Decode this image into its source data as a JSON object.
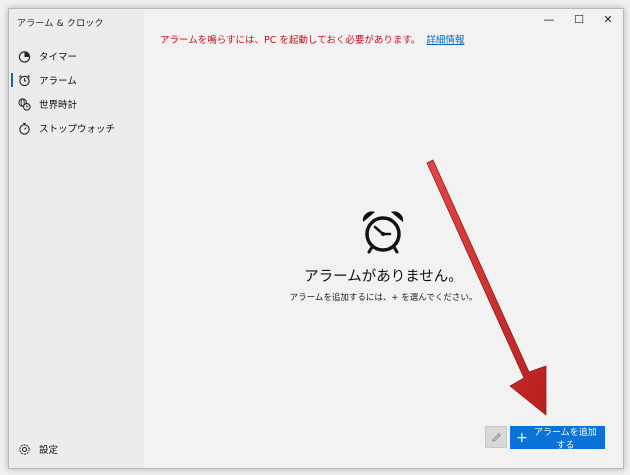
{
  "app": {
    "title": "アラーム & クロック"
  },
  "sidebar": {
    "items": [
      {
        "label": "タイマー",
        "icon": "timer-icon",
        "active": false
      },
      {
        "label": "アラーム",
        "icon": "alarm-icon",
        "active": true
      },
      {
        "label": "世界時計",
        "icon": "world-clock-icon",
        "active": false
      },
      {
        "label": "ストップウォッチ",
        "icon": "stopwatch-icon",
        "active": false
      }
    ],
    "settings_label": "設定"
  },
  "window_controls": {
    "minimize": "—",
    "maximize": "☐",
    "close": "✕"
  },
  "notice": {
    "text": "アラームを鳴らすには、PC を起動しておく必要があります。",
    "link": "詳細情報"
  },
  "empty_state": {
    "title": "アラームがありません。",
    "subtitle": "アラームを追加するには、+ を選んでください。"
  },
  "actions": {
    "add_label": "アラームを追加する"
  },
  "colors": {
    "accent": "#0a73d8",
    "notice": "#c50f1f",
    "annotation_arrow": "#d42e2e"
  }
}
